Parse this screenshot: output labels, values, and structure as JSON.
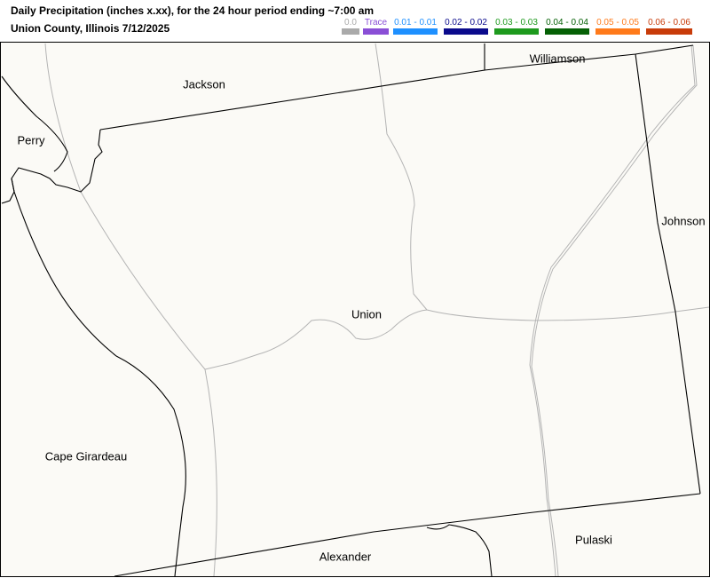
{
  "header": {
    "title_line1": "Daily Precipitation (inches  x.xx),  for the 24 hour period ending ~7:00 am",
    "title_line2": "Union County, Illinois  7/12/2025"
  },
  "legend": [
    {
      "label": "0.0",
      "color": "#aaaaaa",
      "text_color": "#aaaaaa"
    },
    {
      "label": "Trace",
      "color": "#8a4fd6",
      "text_color": "#8a4fd6"
    },
    {
      "label": "0.01 - 0.01",
      "color": "#1e90ff",
      "text_color": "#1e90ff"
    },
    {
      "label": "0.02 - 0.02",
      "color": "#0a0a8c",
      "text_color": "#0a0a8c"
    },
    {
      "label": "0.03 - 0.03",
      "color": "#1e9a1e",
      "text_color": "#1e9a1e"
    },
    {
      "label": "0.04 - 0.04",
      "color": "#056005",
      "text_color": "#056005"
    },
    {
      "label": "0.05 - 0.05",
      "color": "#ff7a1a",
      "text_color": "#ff7a1a"
    },
    {
      "label": "0.06 - 0.06",
      "color": "#c83c0a",
      "text_color": "#c83c0a"
    }
  ],
  "map": {
    "background": "#fbfaf6",
    "county_labels": {
      "jackson": "Jackson",
      "williamson": "Williamson",
      "perry": "Perry",
      "johnson": "Johnson",
      "union": "Union",
      "cape_girardeau": "Cape Girardeau",
      "pulaski": "Pulaski",
      "alexander": "Alexander"
    }
  }
}
